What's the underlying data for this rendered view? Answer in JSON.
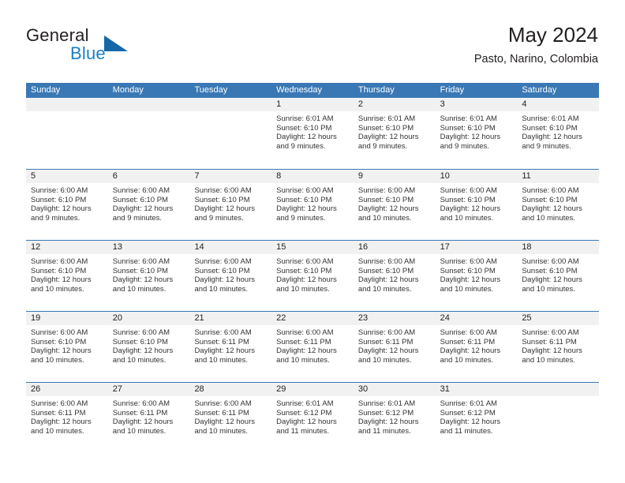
{
  "brand": {
    "name_part1": "General",
    "name_part2": "Blue",
    "logo_icon": "triangle-flag-icon"
  },
  "header": {
    "title": "May 2024",
    "location": "Pasto, Narino, Colombia"
  },
  "calendar": {
    "weekdays": [
      "Sunday",
      "Monday",
      "Tuesday",
      "Wednesday",
      "Thursday",
      "Friday",
      "Saturday"
    ],
    "header_bg": "#3a78b5",
    "day_band_bg": "#f1f1f1",
    "weeks": [
      [
        {
          "date": "",
          "empty": true,
          "sunrise": "",
          "sunset": "",
          "daylight_line1": "",
          "daylight_line2": ""
        },
        {
          "date": "",
          "empty": true,
          "sunrise": "",
          "sunset": "",
          "daylight_line1": "",
          "daylight_line2": ""
        },
        {
          "date": "",
          "empty": true,
          "sunrise": "",
          "sunset": "",
          "daylight_line1": "",
          "daylight_line2": ""
        },
        {
          "date": "1",
          "empty": false,
          "sunrise": "Sunrise: 6:01 AM",
          "sunset": "Sunset: 6:10 PM",
          "daylight_line1": "Daylight: 12 hours",
          "daylight_line2": "and 9 minutes."
        },
        {
          "date": "2",
          "empty": false,
          "sunrise": "Sunrise: 6:01 AM",
          "sunset": "Sunset: 6:10 PM",
          "daylight_line1": "Daylight: 12 hours",
          "daylight_line2": "and 9 minutes."
        },
        {
          "date": "3",
          "empty": false,
          "sunrise": "Sunrise: 6:01 AM",
          "sunset": "Sunset: 6:10 PM",
          "daylight_line1": "Daylight: 12 hours",
          "daylight_line2": "and 9 minutes."
        },
        {
          "date": "4",
          "empty": false,
          "sunrise": "Sunrise: 6:01 AM",
          "sunset": "Sunset: 6:10 PM",
          "daylight_line1": "Daylight: 12 hours",
          "daylight_line2": "and 9 minutes."
        }
      ],
      [
        {
          "date": "5",
          "empty": false,
          "sunrise": "Sunrise: 6:00 AM",
          "sunset": "Sunset: 6:10 PM",
          "daylight_line1": "Daylight: 12 hours",
          "daylight_line2": "and 9 minutes."
        },
        {
          "date": "6",
          "empty": false,
          "sunrise": "Sunrise: 6:00 AM",
          "sunset": "Sunset: 6:10 PM",
          "daylight_line1": "Daylight: 12 hours",
          "daylight_line2": "and 9 minutes."
        },
        {
          "date": "7",
          "empty": false,
          "sunrise": "Sunrise: 6:00 AM",
          "sunset": "Sunset: 6:10 PM",
          "daylight_line1": "Daylight: 12 hours",
          "daylight_line2": "and 9 minutes."
        },
        {
          "date": "8",
          "empty": false,
          "sunrise": "Sunrise: 6:00 AM",
          "sunset": "Sunset: 6:10 PM",
          "daylight_line1": "Daylight: 12 hours",
          "daylight_line2": "and 9 minutes."
        },
        {
          "date": "9",
          "empty": false,
          "sunrise": "Sunrise: 6:00 AM",
          "sunset": "Sunset: 6:10 PM",
          "daylight_line1": "Daylight: 12 hours",
          "daylight_line2": "and 10 minutes."
        },
        {
          "date": "10",
          "empty": false,
          "sunrise": "Sunrise: 6:00 AM",
          "sunset": "Sunset: 6:10 PM",
          "daylight_line1": "Daylight: 12 hours",
          "daylight_line2": "and 10 minutes."
        },
        {
          "date": "11",
          "empty": false,
          "sunrise": "Sunrise: 6:00 AM",
          "sunset": "Sunset: 6:10 PM",
          "daylight_line1": "Daylight: 12 hours",
          "daylight_line2": "and 10 minutes."
        }
      ],
      [
        {
          "date": "12",
          "empty": false,
          "sunrise": "Sunrise: 6:00 AM",
          "sunset": "Sunset: 6:10 PM",
          "daylight_line1": "Daylight: 12 hours",
          "daylight_line2": "and 10 minutes."
        },
        {
          "date": "13",
          "empty": false,
          "sunrise": "Sunrise: 6:00 AM",
          "sunset": "Sunset: 6:10 PM",
          "daylight_line1": "Daylight: 12 hours",
          "daylight_line2": "and 10 minutes."
        },
        {
          "date": "14",
          "empty": false,
          "sunrise": "Sunrise: 6:00 AM",
          "sunset": "Sunset: 6:10 PM",
          "daylight_line1": "Daylight: 12 hours",
          "daylight_line2": "and 10 minutes."
        },
        {
          "date": "15",
          "empty": false,
          "sunrise": "Sunrise: 6:00 AM",
          "sunset": "Sunset: 6:10 PM",
          "daylight_line1": "Daylight: 12 hours",
          "daylight_line2": "and 10 minutes."
        },
        {
          "date": "16",
          "empty": false,
          "sunrise": "Sunrise: 6:00 AM",
          "sunset": "Sunset: 6:10 PM",
          "daylight_line1": "Daylight: 12 hours",
          "daylight_line2": "and 10 minutes."
        },
        {
          "date": "17",
          "empty": false,
          "sunrise": "Sunrise: 6:00 AM",
          "sunset": "Sunset: 6:10 PM",
          "daylight_line1": "Daylight: 12 hours",
          "daylight_line2": "and 10 minutes."
        },
        {
          "date": "18",
          "empty": false,
          "sunrise": "Sunrise: 6:00 AM",
          "sunset": "Sunset: 6:10 PM",
          "daylight_line1": "Daylight: 12 hours",
          "daylight_line2": "and 10 minutes."
        }
      ],
      [
        {
          "date": "19",
          "empty": false,
          "sunrise": "Sunrise: 6:00 AM",
          "sunset": "Sunset: 6:10 PM",
          "daylight_line1": "Daylight: 12 hours",
          "daylight_line2": "and 10 minutes."
        },
        {
          "date": "20",
          "empty": false,
          "sunrise": "Sunrise: 6:00 AM",
          "sunset": "Sunset: 6:10 PM",
          "daylight_line1": "Daylight: 12 hours",
          "daylight_line2": "and 10 minutes."
        },
        {
          "date": "21",
          "empty": false,
          "sunrise": "Sunrise: 6:00 AM",
          "sunset": "Sunset: 6:11 PM",
          "daylight_line1": "Daylight: 12 hours",
          "daylight_line2": "and 10 minutes."
        },
        {
          "date": "22",
          "empty": false,
          "sunrise": "Sunrise: 6:00 AM",
          "sunset": "Sunset: 6:11 PM",
          "daylight_line1": "Daylight: 12 hours",
          "daylight_line2": "and 10 minutes."
        },
        {
          "date": "23",
          "empty": false,
          "sunrise": "Sunrise: 6:00 AM",
          "sunset": "Sunset: 6:11 PM",
          "daylight_line1": "Daylight: 12 hours",
          "daylight_line2": "and 10 minutes."
        },
        {
          "date": "24",
          "empty": false,
          "sunrise": "Sunrise: 6:00 AM",
          "sunset": "Sunset: 6:11 PM",
          "daylight_line1": "Daylight: 12 hours",
          "daylight_line2": "and 10 minutes."
        },
        {
          "date": "25",
          "empty": false,
          "sunrise": "Sunrise: 6:00 AM",
          "sunset": "Sunset: 6:11 PM",
          "daylight_line1": "Daylight: 12 hours",
          "daylight_line2": "and 10 minutes."
        }
      ],
      [
        {
          "date": "26",
          "empty": false,
          "sunrise": "Sunrise: 6:00 AM",
          "sunset": "Sunset: 6:11 PM",
          "daylight_line1": "Daylight: 12 hours",
          "daylight_line2": "and 10 minutes."
        },
        {
          "date": "27",
          "empty": false,
          "sunrise": "Sunrise: 6:00 AM",
          "sunset": "Sunset: 6:11 PM",
          "daylight_line1": "Daylight: 12 hours",
          "daylight_line2": "and 10 minutes."
        },
        {
          "date": "28",
          "empty": false,
          "sunrise": "Sunrise: 6:00 AM",
          "sunset": "Sunset: 6:11 PM",
          "daylight_line1": "Daylight: 12 hours",
          "daylight_line2": "and 10 minutes."
        },
        {
          "date": "29",
          "empty": false,
          "sunrise": "Sunrise: 6:01 AM",
          "sunset": "Sunset: 6:12 PM",
          "daylight_line1": "Daylight: 12 hours",
          "daylight_line2": "and 11 minutes."
        },
        {
          "date": "30",
          "empty": false,
          "sunrise": "Sunrise: 6:01 AM",
          "sunset": "Sunset: 6:12 PM",
          "daylight_line1": "Daylight: 12 hours",
          "daylight_line2": "and 11 minutes."
        },
        {
          "date": "31",
          "empty": false,
          "sunrise": "Sunrise: 6:01 AM",
          "sunset": "Sunset: 6:12 PM",
          "daylight_line1": "Daylight: 12 hours",
          "daylight_line2": "and 11 minutes."
        },
        {
          "date": "",
          "empty": true,
          "sunrise": "",
          "sunset": "",
          "daylight_line1": "",
          "daylight_line2": ""
        }
      ]
    ]
  }
}
